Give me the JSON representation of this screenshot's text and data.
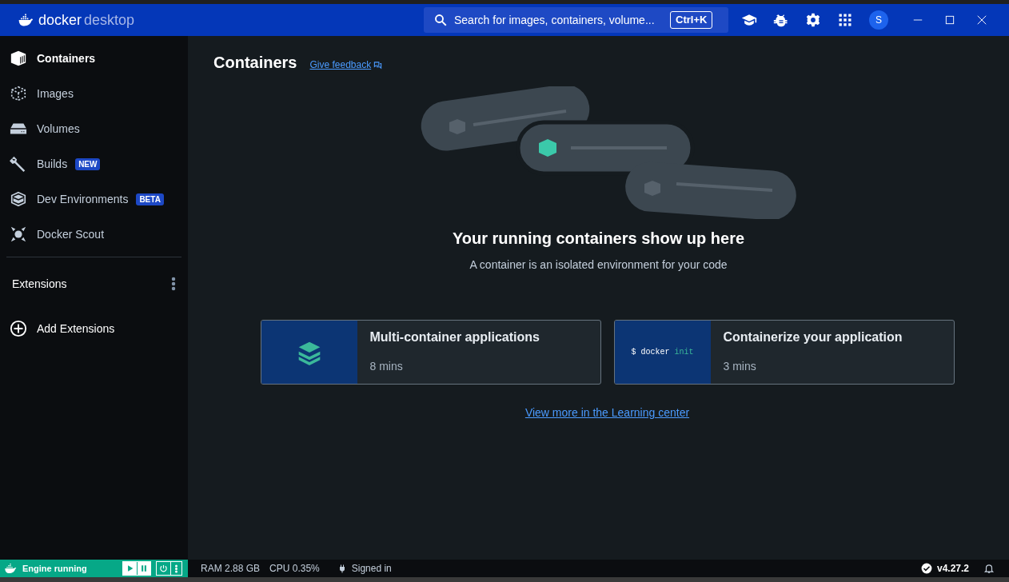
{
  "titlebar": {
    "logo_primary": "docker",
    "logo_secondary": "desktop",
    "search": {
      "placeholder": "Search for images, containers, volume...",
      "shortcut": "Ctrl+K"
    },
    "avatar": "S"
  },
  "sidebar": {
    "items": [
      {
        "label": "Containers",
        "selected": true
      },
      {
        "label": "Images",
        "selected": false
      },
      {
        "label": "Volumes",
        "selected": false
      },
      {
        "label": "Builds",
        "selected": false,
        "badge": "NEW"
      },
      {
        "label": "Dev Environments",
        "selected": false,
        "badge": "BETA"
      },
      {
        "label": "Docker Scout",
        "selected": false
      }
    ],
    "extensions_heading": "Extensions",
    "add_extensions": "Add Extensions"
  },
  "main": {
    "title": "Containers",
    "feedback_link": "Give feedback",
    "empty_title": "Your running containers show up here",
    "empty_subtitle": "A container is an isolated environment for your code",
    "cards": [
      {
        "title": "Multi-container applications",
        "duration": "8 mins",
        "thumbnail": {
          "kind": "stack"
        }
      },
      {
        "title": "Containerize your application",
        "duration": "3 mins",
        "thumbnail": {
          "kind": "code",
          "command": "$ docker",
          "argument": "init"
        }
      }
    ],
    "learning_link": "View more in the Learning center"
  },
  "status_bar": {
    "engine": "Engine running",
    "ram": "RAM 2.88 GB",
    "cpu": "CPU 0.35%",
    "account": "Signed in",
    "version": "v4.27.2"
  }
}
